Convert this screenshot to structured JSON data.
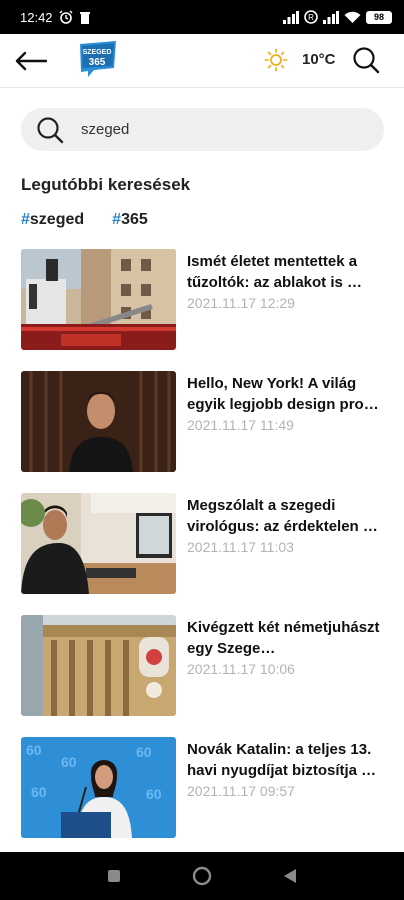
{
  "status_bar": {
    "time": "12:42",
    "battery": "98"
  },
  "header": {
    "logo_text_top": "SZEGED",
    "logo_text_bottom": "365",
    "temperature": "10°C"
  },
  "search": {
    "value": "szeged"
  },
  "recent": {
    "title": "Legutóbbi keresések",
    "tags": [
      {
        "hash": "#",
        "label": "szeged"
      },
      {
        "hash": "#",
        "label": "365"
      }
    ]
  },
  "articles": [
    {
      "title": "Ismét életet mentettek a tűzoltók: az ablakot is …",
      "date": "2021.11.17 12:29"
    },
    {
      "title": "Hello, New York! A világ egyik legjobb design pro…",
      "date": "2021.11.17 11:49"
    },
    {
      "title": "Megszólalt a szegedi virológus: az érdektelen …",
      "date": "2021.11.17 11:03"
    },
    {
      "title": "Kivégzett két németjuhászt egy Szege…",
      "date": "2021.11.17 10:06"
    },
    {
      "title": "Novák Katalin: a teljes 13. havi nyugdíjat biztosítja …",
      "date": "2021.11.17 09:57"
    }
  ],
  "colors": {
    "accent": "#1f84c7",
    "date": "#b3b3b3",
    "search_bg": "#efefef"
  },
  "icons": [
    "back-arrow-icon",
    "sun-icon",
    "search-icon",
    "square-icon",
    "circle-icon",
    "triangle-back-icon"
  ]
}
